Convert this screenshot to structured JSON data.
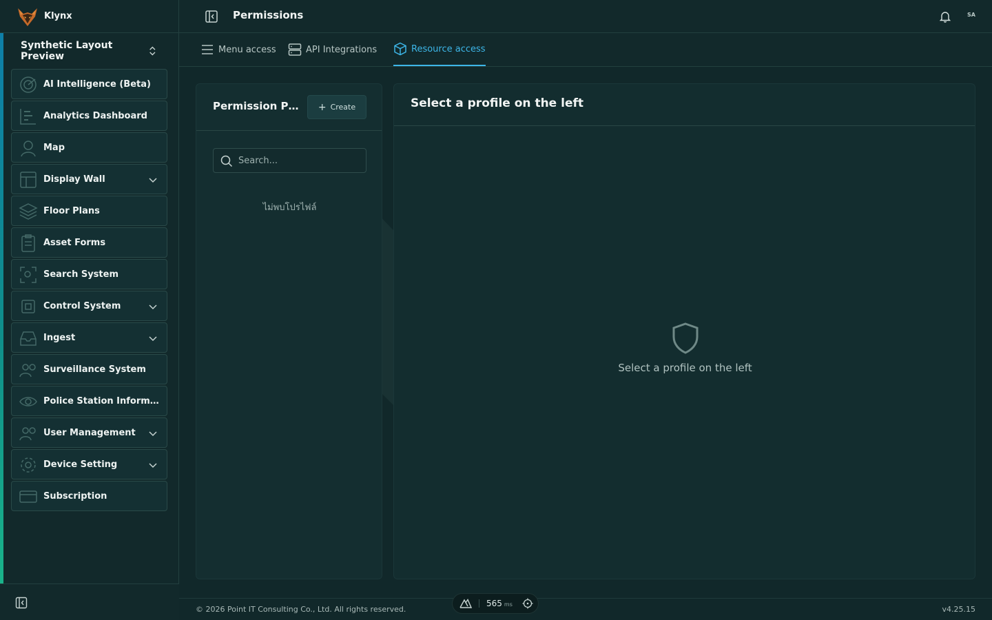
{
  "app": {
    "name": "Klynx"
  },
  "workspace": {
    "label": "Synthetic Layout Preview"
  },
  "sidebar": {
    "items": [
      {
        "label": "AI Intelligence (Beta)",
        "icon": "radar-icon",
        "has_children": false
      },
      {
        "label": "Analytics Dashboard",
        "icon": "chart-icon",
        "has_children": false
      },
      {
        "label": "Map",
        "icon": "map-pin-icon",
        "has_children": false
      },
      {
        "label": "Display Wall",
        "icon": "layout-icon",
        "has_children": true
      },
      {
        "label": "Floor Plans",
        "icon": "layers-icon",
        "has_children": false
      },
      {
        "label": "Asset Forms",
        "icon": "clipboard-icon",
        "has_children": false
      },
      {
        "label": "Search System",
        "icon": "scan-icon",
        "has_children": false
      },
      {
        "label": "Control System",
        "icon": "cpu-icon",
        "has_children": true
      },
      {
        "label": "Ingest",
        "icon": "inbox-icon",
        "has_children": true
      },
      {
        "label": "Surveillance System",
        "icon": "users-icon",
        "has_children": false
      },
      {
        "label": "Police Station Information",
        "icon": "eye-icon",
        "has_children": false
      },
      {
        "label": "User Management",
        "icon": "users-icon",
        "has_children": true
      },
      {
        "label": "Device Setting",
        "icon": "gear-icon",
        "has_children": true
      },
      {
        "label": "Subscription",
        "icon": "credit-card-icon",
        "has_children": false
      }
    ]
  },
  "header": {
    "title": "Permissions",
    "avatar_initials": "SA"
  },
  "tabs": [
    {
      "label": "Menu access",
      "icon": "menu-icon",
      "active": false
    },
    {
      "label": "API Integrations",
      "icon": "server-icon",
      "active": false
    },
    {
      "label": "Resource access",
      "icon": "box-icon",
      "active": true
    }
  ],
  "profiles_panel": {
    "title": "Permission Profiles",
    "create_label": "Create",
    "search_placeholder": "Search...",
    "empty_text": "ไม่พบโปรไฟล์"
  },
  "detail_panel": {
    "title": "Select a profile on the left",
    "empty_text": "Select a profile on the left"
  },
  "footer": {
    "copyright": "© 2026 Point IT Consulting Co., Ltd. All rights reserved.",
    "version": "v4.25.15"
  },
  "perf": {
    "value": "565",
    "unit": "ms"
  },
  "colors": {
    "accent": "#3db6e8",
    "background": "#0f2224",
    "panel": "#142e30"
  }
}
